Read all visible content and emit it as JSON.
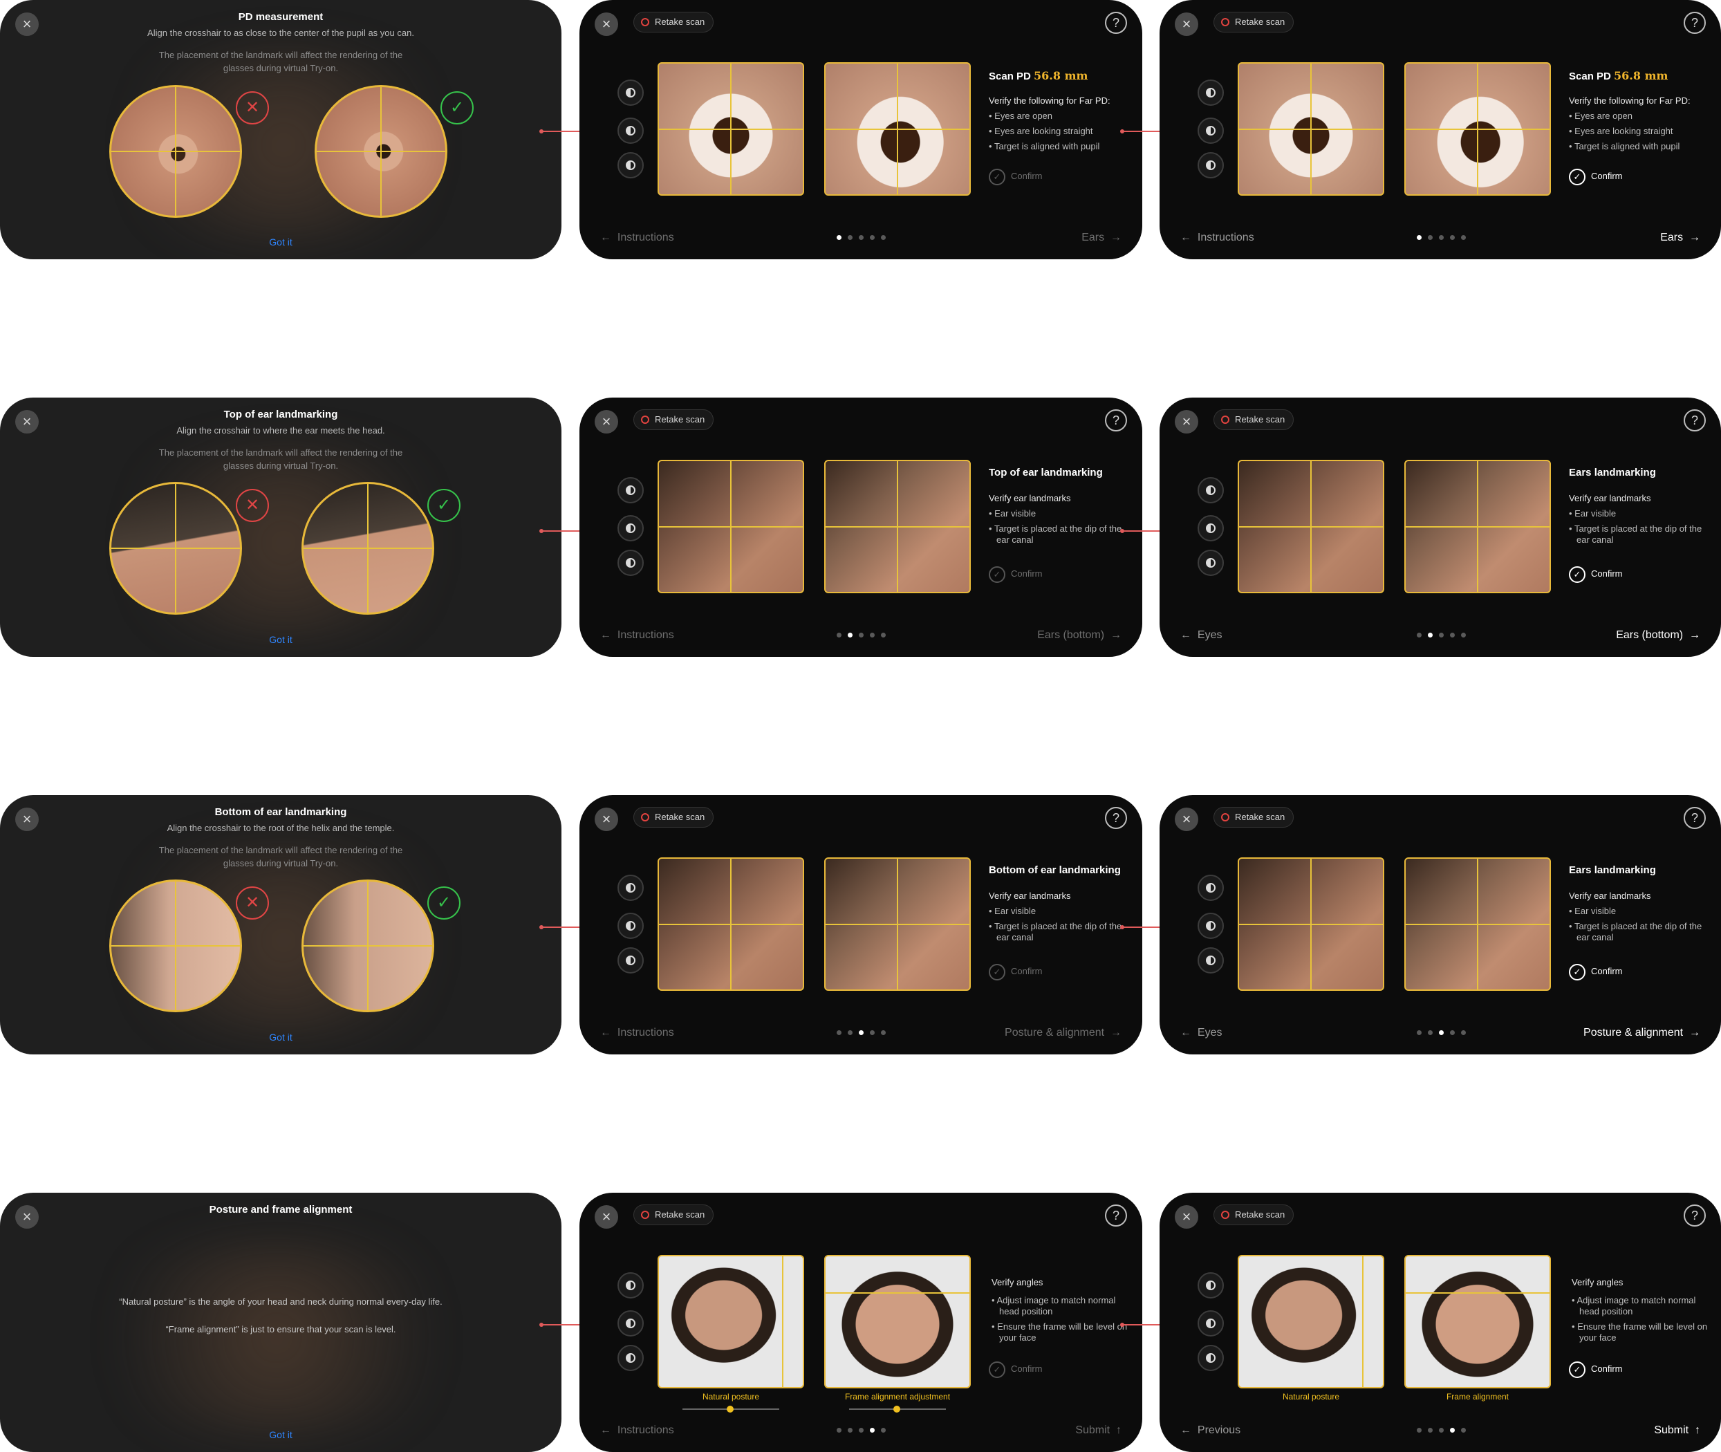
{
  "common": {
    "close_icon": "×",
    "retake_label": "Retake scan",
    "help_icon": "?",
    "got_it": "Got it",
    "confirm_label": "Confirm",
    "check_icon": "✓",
    "cross_icon": "✕",
    "arrow_left": "←",
    "arrow_right": "→",
    "arrow_up": "↑"
  },
  "row1": {
    "instr": {
      "title": "PD measurement",
      "subtitle": "Align the crosshair to as close to the center of the pupil as you can.",
      "note": "The placement of the landmark will affect the rendering of the\nglasses during virtual Try-on."
    },
    "review": {
      "title_prefix": "Scan PD ",
      "pd_value": "56.8 mm",
      "verify_heading": "Verify the following for Far PD:",
      "items": [
        "Eyes are open",
        "Eyes are looking straight",
        "Target is aligned with pupil"
      ]
    },
    "p2": {
      "prev": "Instructions",
      "next": "Ears"
    },
    "p3": {
      "prev": "Instructions",
      "next": "Ears"
    }
  },
  "row2": {
    "instr": {
      "title": "Top of ear landmarking",
      "subtitle": "Align the crosshair to where the ear meets the head.",
      "note": "The placement of the landmark will affect the rendering of the\nglasses during virtual Try-on."
    },
    "p2": {
      "title": "Top of ear landmarking",
      "verify_heading": "Verify ear landmarks",
      "items": [
        "Ear visible",
        "Target is placed at the dip of the ear canal"
      ],
      "prev": "Instructions",
      "next": "Ears (bottom)"
    },
    "p3": {
      "title": "Ears landmarking",
      "verify_heading": "Verify ear landmarks",
      "items": [
        "Ear visible",
        "Target is placed at the dip of the ear canal"
      ],
      "prev": "Eyes",
      "next": "Ears (bottom)"
    }
  },
  "row3": {
    "instr": {
      "title": "Bottom of ear landmarking",
      "subtitle": "Align the crosshair to the root of the helix and the temple.",
      "note": "The placement of the landmark will affect the rendering of the\nglasses during virtual Try-on."
    },
    "p2": {
      "title": "Bottom of ear landmarking",
      "verify_heading": "Verify ear landmarks",
      "items": [
        "Ear visible",
        "Target is placed at the dip of the ear canal"
      ],
      "prev": "Instructions",
      "next": "Posture & alignment"
    },
    "p3": {
      "title": "Ears landmarking",
      "verify_heading": "Verify ear landmarks",
      "items": [
        "Ear visible",
        "Target is placed at the dip of the ear canal"
      ],
      "prev": "Eyes",
      "next": "Posture & alignment"
    }
  },
  "row4": {
    "instr": {
      "title": "Posture and frame alignment",
      "line1": "“Natural posture” is the angle of your head and neck during normal every-day life.",
      "line2": "“Frame alignment” is just to ensure that your scan is level."
    },
    "p2": {
      "verify_heading": "Verify angles",
      "items": [
        "Adjust image to match normal head position",
        "Ensure the frame will be level on your face"
      ],
      "label_left": "Natural posture",
      "label_right": "Frame alignment adjustment",
      "prev": "Instructions",
      "next": "Submit"
    },
    "p3": {
      "verify_heading": "Verify angles",
      "items": [
        "Adjust image to match normal head position",
        "Ensure the frame will be level on your face"
      ],
      "label_left": "Natural posture",
      "label_right": "Frame alignment",
      "prev": "Previous",
      "next": "Submit"
    }
  },
  "progress": {
    "total_steps": 5,
    "row1_step": 1,
    "row2_step": 2,
    "row3_step": 3,
    "row4_step": 4
  },
  "colors": {
    "accent": "#e8b93a",
    "pd": "#f0b52c",
    "link": "#2f86ff",
    "good": "#36c24b",
    "bad": "#e04545",
    "connector": "#e05a5a"
  },
  "icons": {
    "close": "close-icon",
    "help": "help-icon",
    "retake": "retake-icon",
    "contrast": "contrast-icon",
    "check": "check-icon",
    "cross": "cross-icon"
  }
}
